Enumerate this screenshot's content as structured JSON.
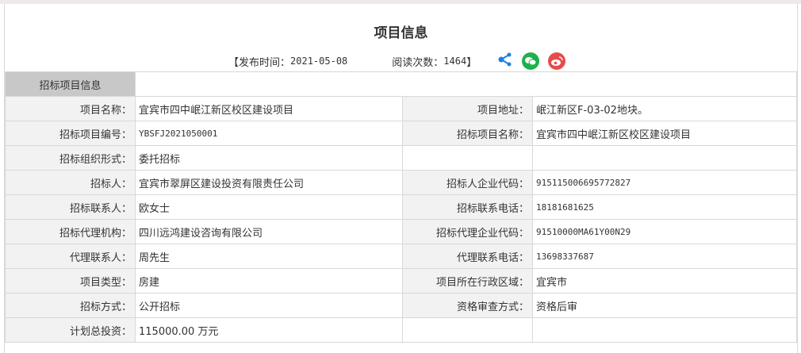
{
  "title": "项目信息",
  "meta": {
    "publish_label": "【发布时间：",
    "publish_date": "2021-05-08",
    "read_label": "阅读次数：",
    "read_count": "1464",
    "close": "】"
  },
  "section": "招标项目信息",
  "rows": [
    {
      "l1": "项目名称：",
      "v1": "宜宾市四中岷江新区校区建设项目",
      "l2": "项目地址：",
      "v2": "岷江新区F-03-02地块。"
    },
    {
      "l1": "招标项目编号：",
      "v1": "YBSFJ2021050001",
      "l2": "招标项目名称：",
      "v2": "宜宾市四中岷江新区校区建设项目"
    },
    {
      "l1": "招标组织形式：",
      "v1": "委托招标",
      "l2": "",
      "v2": ""
    },
    {
      "l1": "招标人：",
      "v1": "宜宾市翠屏区建设投资有限责任公司",
      "l2": "招标人企业代码：",
      "v2": "915115006695772827"
    },
    {
      "l1": "招标联系人：",
      "v1": "欧女士",
      "l2": "招标联系电话：",
      "v2": "18181681625"
    },
    {
      "l1": "招标代理机构：",
      "v1": "四川远鸿建设咨询有限公司",
      "l2": "招标代理企业代码：",
      "v2": "91510000MA61Y00N29"
    },
    {
      "l1": "代理联系人：",
      "v1": "周先生",
      "l2": "代理联系电话：",
      "v2": "13698337687"
    },
    {
      "l1": "项目类型：",
      "v1": "房建",
      "l2": "项目所在行政区域：",
      "v2": "宜宾市"
    },
    {
      "l1": "招标方式：",
      "v1": "公开招标",
      "l2": "资格审查方式：",
      "v2": "资格后审"
    },
    {
      "l1": "计划总投资：",
      "v1": "115000.00 万元",
      "l2": "",
      "v2": ""
    }
  ]
}
